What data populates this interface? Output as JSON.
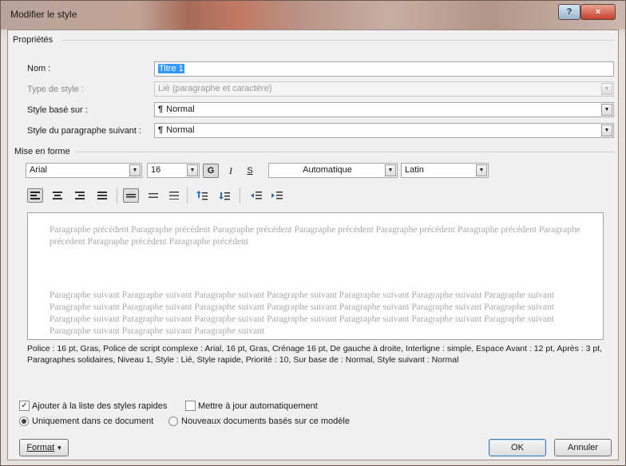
{
  "window": {
    "title": "Modifier le style",
    "help_glyph": "?",
    "close_glyph": "×"
  },
  "properties": {
    "group_label": "Propriétés",
    "name_label": "Nom :",
    "name_value": "Titre 1",
    "type_label": "Type de style :",
    "type_value": "Lié (paragraphe et caractère)",
    "based_on_label": "Style basé sur :",
    "based_on_value": "Normal",
    "next_label": "Style du paragraphe suivant :",
    "next_value": "Normal",
    "pilcrow": "¶"
  },
  "formatting": {
    "group_label": "Mise en forme",
    "font": "Arial",
    "size": "16",
    "bold": "G",
    "italic": "I",
    "underline": "S",
    "color": "Automatique",
    "script": "Latin"
  },
  "preview": {
    "previous_text": "Paragraphe précédent Paragraphe précédent Paragraphe précédent Paragraphe précédent Paragraphe précédent Paragraphe précédent Paragraphe précédent Paragraphe précédent Paragraphe précédent",
    "next_text": "Paragraphe suivant Paragraphe suivant Paragraphe suivant Paragraphe suivant Paragraphe suivant Paragraphe suivant Paragraphe suivant Paragraphe suivant Paragraphe suivant Paragraphe suivant Paragraphe suivant Paragraphe suivant Paragraphe suivant Paragraphe suivant Paragraphe suivant Paragraphe suivant Paragraphe suivant Paragraphe suivant Paragraphe suivant Paragraphe suivant Paragraphe suivant Paragraphe suivant Paragraphe suivant Paragraphe suivant"
  },
  "description": "Police : 16 pt, Gras, Police de script complexe : Arial, 16 pt, Gras, Crénage 16 pt, De gauche à droite, Interligne : simple, Espace Avant : 12 pt, Après : 3 pt, Paragraphes solidaires, Niveau 1, Style : Lié, Style rapide, Priorité : 10, Sur base de : Normal, Style suivant : Normal",
  "options": {
    "add_quick_label": "Ajouter à la liste des styles rapides",
    "add_quick_checked": true,
    "auto_update_label": "Mettre à jour automatiquement",
    "auto_update_checked": false,
    "only_doc_label": "Uniquement dans ce document",
    "new_docs_label": "Nouveaux documents basés sur ce modèle"
  },
  "buttons": {
    "format": "Format",
    "format_arrow": "▾",
    "ok": "OK",
    "cancel": "Annuler"
  },
  "icons": {
    "dropdown": "▼"
  }
}
